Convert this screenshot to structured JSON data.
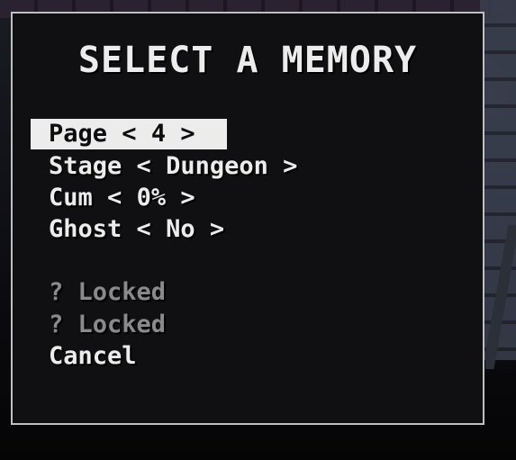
{
  "dialog": {
    "title": "SELECT A MEMORY"
  },
  "menu": {
    "page": {
      "label": "Page",
      "value": "4"
    },
    "stage": {
      "label": "Stage",
      "value": "Dungeon"
    },
    "cum": {
      "label": "Cum",
      "value": "0%"
    },
    "ghost": {
      "label": "Ghost",
      "value": "No"
    },
    "arrow_left": "<",
    "arrow_right": ">",
    "locked_items": [
      {
        "label": "? Locked"
      },
      {
        "label": "? Locked"
      }
    ],
    "cancel_label": "Cancel"
  }
}
